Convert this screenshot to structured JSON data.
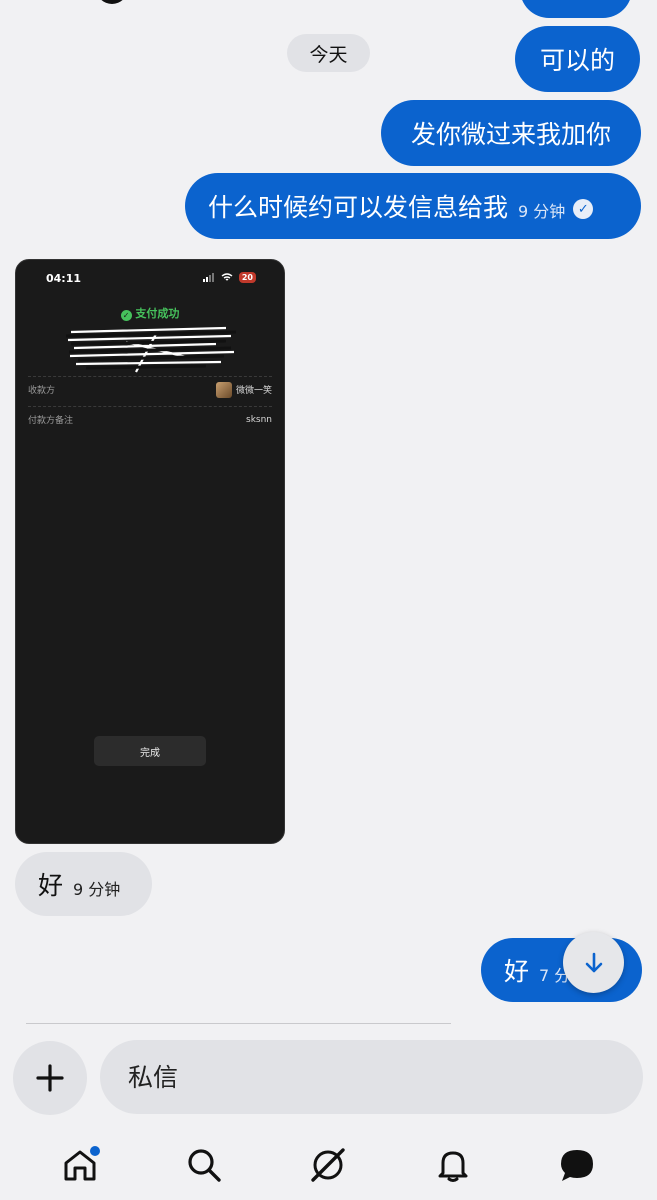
{
  "date_label": "今天",
  "messages_out": [
    {
      "text": "可以的"
    },
    {
      "text": "发你微过来我加你"
    },
    {
      "text": "什么时候约可以发信息给我",
      "time": "9 分钟",
      "read": true
    },
    {
      "text": "好",
      "time": "7 分"
    }
  ],
  "messages_in": [
    {
      "text": "好",
      "time": "9 分钟"
    }
  ],
  "screenshot": {
    "status_time": "04:11",
    "battery": "20",
    "success": "支付成功",
    "rows": [
      {
        "label": "收款方",
        "value": "微微一笑"
      },
      {
        "label": "付款方备注",
        "value": "sksnn"
      }
    ],
    "done_button": "完成"
  },
  "composer": {
    "placeholder": "私信"
  },
  "colors": {
    "accent": "#0b63ce",
    "background": "#f1f1f3",
    "bubble_in": "#e1e2e6"
  },
  "nav_icons": [
    "home-icon",
    "search-icon",
    "explore-icon",
    "bell-icon",
    "messages-icon"
  ]
}
